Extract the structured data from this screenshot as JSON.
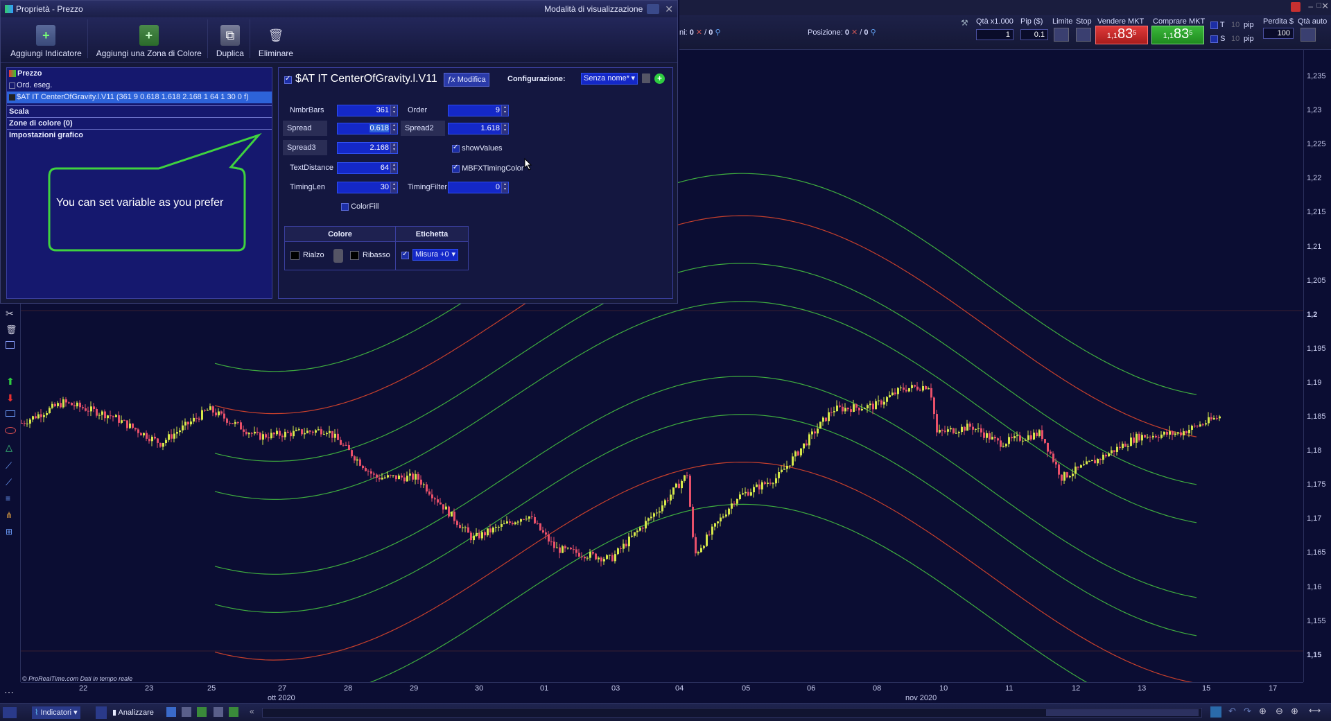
{
  "dialog": {
    "title": "Proprietà - Prezzo",
    "view_mode_label": "Modalità di visualizzazione",
    "toolbar": {
      "add_indicator": "Aggiungi Indicatore",
      "add_color_zone": "Aggiungi una Zona di Colore",
      "duplicate": "Duplica",
      "delete": "Eliminare"
    },
    "tree": {
      "price": "Prezzo",
      "orders": "Ord. eseg.",
      "indicator": "$AT IT CenterOfGravity.l.V11 (361 9 0.618 1.618 2.168 1 64 1 30 0 f)",
      "scale": "Scala",
      "color_zones": "Zone di colore (0)",
      "chart_settings": "Impostazioni grafico"
    },
    "callout": "You can set variable as you prefer",
    "indicator_name": "$AT IT CenterOfGravity.l.V11",
    "modify_label": "Modifica",
    "config_label": "Configurazione:",
    "config_value": "Senza nome*",
    "params": {
      "nmbr_bars_label": "NmbrBars",
      "nmbr_bars": "361",
      "order_label": "Order",
      "order": "9",
      "spread_label": "Spread",
      "spread": "0.618",
      "spread2_label": "Spread2",
      "spread2": "1.618",
      "spread3_label": "Spread3",
      "spread3": "2.168",
      "show_values_label": "showValues",
      "text_distance_label": "TextDistance",
      "text_distance": "64",
      "mbfx_label": "MBFXTimingColor",
      "timing_len_label": "TimingLen",
      "timing_len": "30",
      "timing_filter_label": "TimingFilter",
      "timing_filter": "0",
      "color_fill_label": "ColorFill"
    },
    "color_table": {
      "colore_header": "Colore",
      "etichetta_header": "Etichetta",
      "rialzo": "Rialzo",
      "ribasso": "Ribasso",
      "misura": "Misura +0"
    }
  },
  "trade_bar": {
    "ni_label": "ni:",
    "ni_value1": "0",
    "ni_value2": "0",
    "position_label": "Posizione:",
    "position_value1": "0",
    "position_value2": "0",
    "qty_label": "Qtà x1.000",
    "qty_value": "1",
    "pip_label": "Pip ($)",
    "pip_value": "0.1",
    "limit_label": "Limite",
    "stop_label": "Stop",
    "sell_label": "Vendere MKT",
    "sell_price_prefix": "1,1",
    "sell_price_main": "83",
    "sell_price_sup": "5",
    "buy_label": "Comprare MKT",
    "buy_price_prefix": "1,1",
    "buy_price_main": "83",
    "buy_price_sup": "5",
    "t_label": "T",
    "s_label": "S",
    "pip_t": "10",
    "pip_s": "10",
    "pip_unit": "pip",
    "loss_label": "Perdita $",
    "loss_value": "100",
    "qty_auto_label": "Qtà auto"
  },
  "price_axis": [
    "1,235",
    "1,23",
    "1,225",
    "1,22",
    "1,215",
    "1,21",
    "1,205",
    "1,2",
    "1,195",
    "1,19",
    "1,185",
    "1,18",
    "1,175",
    "1,17",
    "1,165",
    "1,16",
    "1,155",
    "1,15"
  ],
  "time_axis": {
    "labels": [
      "22",
      "23",
      "25",
      "27",
      "28",
      "29",
      "30",
      "01",
      "03",
      "04",
      "05",
      "06",
      "08",
      "10",
      "11",
      "12",
      "13",
      "15",
      "17"
    ],
    "month1": "ott 2020",
    "month2": "nov 2020"
  },
  "watermark": "© ProRealTime.com  Dati in tempo reale",
  "bottom_bar": {
    "indicators": "Indicatori",
    "analyze": "Analizzare"
  },
  "colors": {
    "background": "#0b0d33",
    "bull_candle": "#d6e84a",
    "bear_candle": "#e8506a",
    "band_green": "#3fae3f",
    "band_red": "#c8402c",
    "sell_bg": "#cc2a2a",
    "buy_bg": "#2a9a2a"
  }
}
